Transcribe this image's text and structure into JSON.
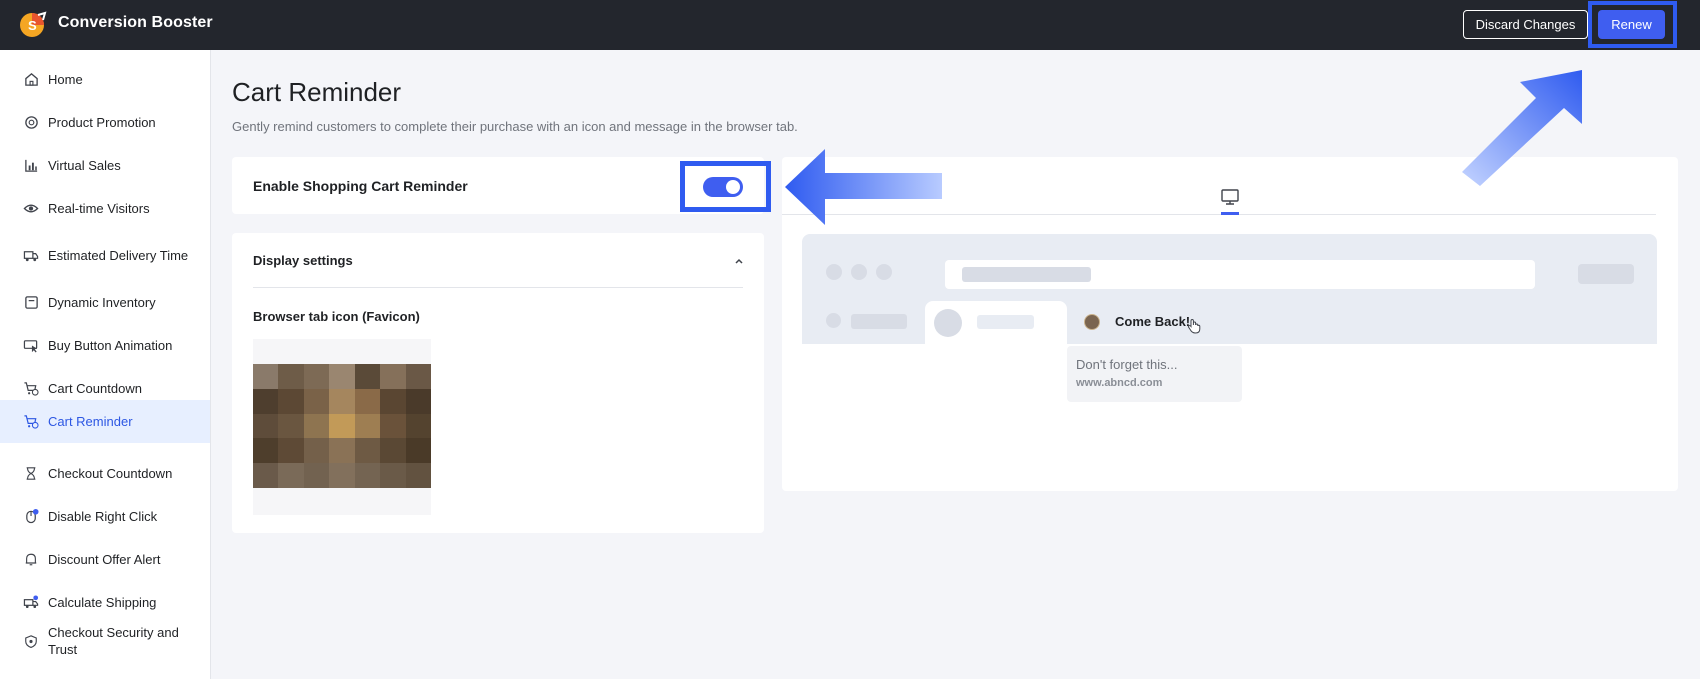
{
  "header": {
    "app_title": "Conversion Booster",
    "discard_label": "Discard Changes",
    "renew_label": "Renew",
    "accent_color": "#3f5ef0"
  },
  "sidebar": {
    "items": [
      {
        "label": "Home",
        "icon": "home-icon"
      },
      {
        "label": "Product Promotion",
        "icon": "badge-icon"
      },
      {
        "label": "Virtual Sales",
        "icon": "bar-chart-icon"
      },
      {
        "label": "Real-time Visitors",
        "icon": "eye-icon"
      },
      {
        "label": "Estimated Delivery Time",
        "icon": "truck-icon"
      },
      {
        "label": "Dynamic Inventory",
        "icon": "inventory-icon"
      },
      {
        "label": "Buy Button Animation",
        "icon": "cursor-icon"
      },
      {
        "label": "Cart Countdown",
        "icon": "cart-clock-icon"
      },
      {
        "label": "Cart Reminder",
        "icon": "cart-reminder-icon",
        "active": true
      },
      {
        "label": "Checkout Countdown",
        "icon": "hourglass-icon"
      },
      {
        "label": "Disable Right Click",
        "icon": "mouse-icon"
      },
      {
        "label": "Discount Offer Alert",
        "icon": "bell-icon"
      },
      {
        "label": "Calculate Shipping",
        "icon": "shipping-icon"
      },
      {
        "label": "Checkout Security and Trust",
        "icon": "shield-icon"
      }
    ]
  },
  "main": {
    "title": "Cart Reminder",
    "subtitle": "Gently remind customers to complete their purchase with an icon and message in the browser tab.",
    "enable_label": "Enable Shopping Cart Reminder",
    "enabled": true,
    "display_settings": {
      "title": "Display settings",
      "favicon_label": "Browser tab icon (Favicon)"
    }
  },
  "preview": {
    "tab_title": "Come Back!",
    "tooltip_title": "Don't forget this...",
    "tooltip_url": "www.abncd.com"
  }
}
